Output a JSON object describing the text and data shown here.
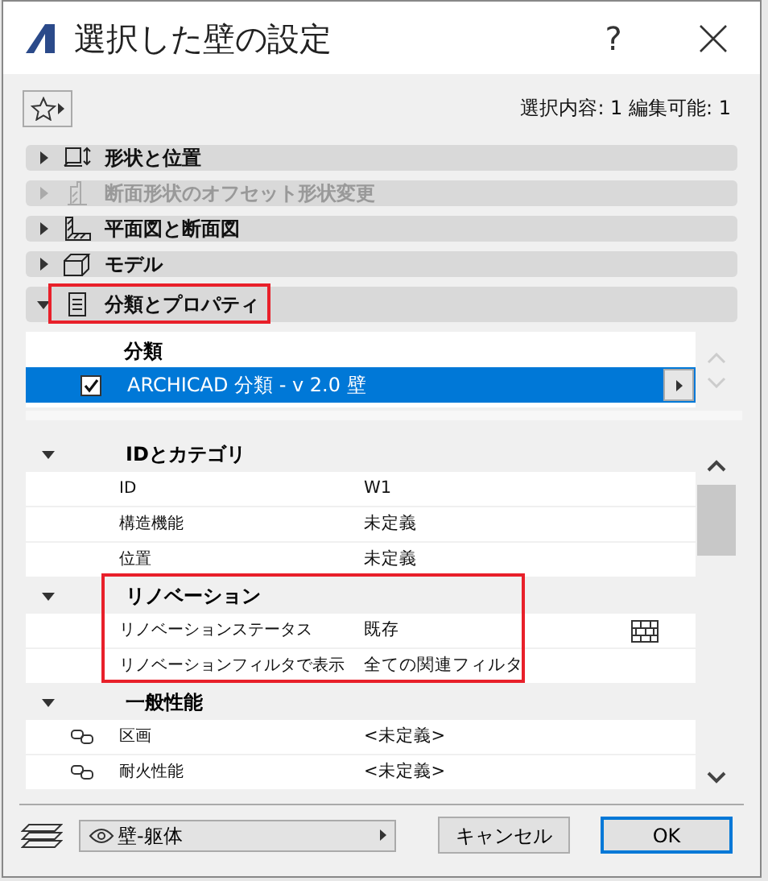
{
  "window": {
    "title": "選択した壁の設定",
    "help": "?"
  },
  "selection_info": "選択内容: 1 編集可能: 1",
  "sections": [
    {
      "label": "形状と位置",
      "expanded": false,
      "disabled": false,
      "highlighted": false
    },
    {
      "label": "断面形状のオフセット形状変更",
      "expanded": false,
      "disabled": true,
      "highlighted": false
    },
    {
      "label": "平面図と断面図",
      "expanded": false,
      "disabled": false,
      "highlighted": false
    },
    {
      "label": "モデル",
      "expanded": false,
      "disabled": false,
      "highlighted": false
    },
    {
      "label": "分類とプロパティ",
      "expanded": true,
      "disabled": false,
      "highlighted": true
    }
  ],
  "classification": {
    "heading": "分類",
    "rows": [
      {
        "label": "ARCHICAD 分類 - v 2.0 壁",
        "checked": true,
        "selected": true
      }
    ]
  },
  "property_groups": [
    {
      "title": "IDとカテゴリ",
      "expanded": true,
      "highlighted": false,
      "rows": [
        {
          "kind": "plain",
          "name": "ID",
          "value": "W1"
        },
        {
          "kind": "plain",
          "name": "構造機能",
          "value": "未定義"
        },
        {
          "kind": "plain",
          "name": "位置",
          "value": "未定義"
        }
      ]
    },
    {
      "title": "リノベーション",
      "expanded": true,
      "highlighted": true,
      "rows": [
        {
          "kind": "status",
          "name": "リノベーションステータス",
          "value": "既存"
        },
        {
          "kind": "plain",
          "name": "リノベーションフィルタで表示",
          "value": "全ての関連フィルタ"
        }
      ]
    },
    {
      "title": "一般性能",
      "expanded": true,
      "highlighted": false,
      "rows": [
        {
          "kind": "linked",
          "name": "区画",
          "value": "<未定義>"
        },
        {
          "kind": "linked",
          "name": "耐火性能",
          "value": "<未定義>"
        }
      ]
    }
  ],
  "footer": {
    "layer": "壁-躯体",
    "buttons": [
      {
        "label": "キャンセル",
        "default": false
      },
      {
        "label": "OK",
        "default": true
      }
    ]
  }
}
